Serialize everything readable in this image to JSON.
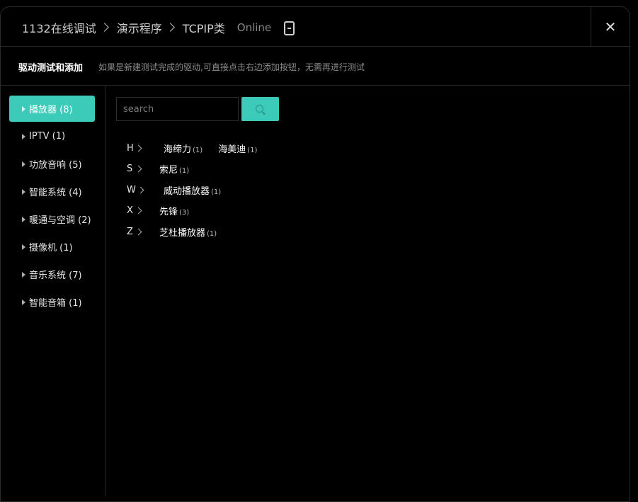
{
  "breadcrumb": [
    "1132在线调试",
    "演示程序",
    "TCPIP类"
  ],
  "status": "Online",
  "icons": {
    "device": "phone-icon",
    "close": "close-icon",
    "search": "search-icon"
  },
  "colors": {
    "accent": "#3ccbb9",
    "background": "#000000"
  },
  "subheader": {
    "title": "驱动测试和添加",
    "hint": "如果是新建测试完成的驱动,可直接点击右边添加按钮，无需再进行测试"
  },
  "sidebar": {
    "items": [
      {
        "label": "播放器 (8)",
        "active": true
      },
      {
        "label": "IPTV (1)",
        "active": false
      },
      {
        "label": "功放音响 (5)",
        "active": false
      },
      {
        "label": "智能系统 (4)",
        "active": false
      },
      {
        "label": "暖通与空调 (2)",
        "active": false
      },
      {
        "label": "摄像机 (1)",
        "active": false
      },
      {
        "label": "音乐系统 (7)",
        "active": false
      },
      {
        "label": "智能音箱 (1)",
        "active": false
      }
    ]
  },
  "search": {
    "placeholder": "search",
    "value": ""
  },
  "groups": [
    {
      "letter": "H",
      "brands": [
        {
          "name": "海缔力",
          "count": "(1)"
        },
        {
          "name": "海美迪",
          "count": "(1)"
        }
      ]
    },
    {
      "letter": "S",
      "brands": [
        {
          "name": "索尼",
          "count": "(1)"
        }
      ]
    },
    {
      "letter": "W",
      "brands": [
        {
          "name": "威动播放器",
          "count": "(1)"
        }
      ]
    },
    {
      "letter": "X",
      "brands": [
        {
          "name": "先锋",
          "count": "(3)"
        }
      ]
    },
    {
      "letter": "Z",
      "brands": [
        {
          "name": "芝杜播放器",
          "count": "(1)"
        }
      ]
    }
  ]
}
